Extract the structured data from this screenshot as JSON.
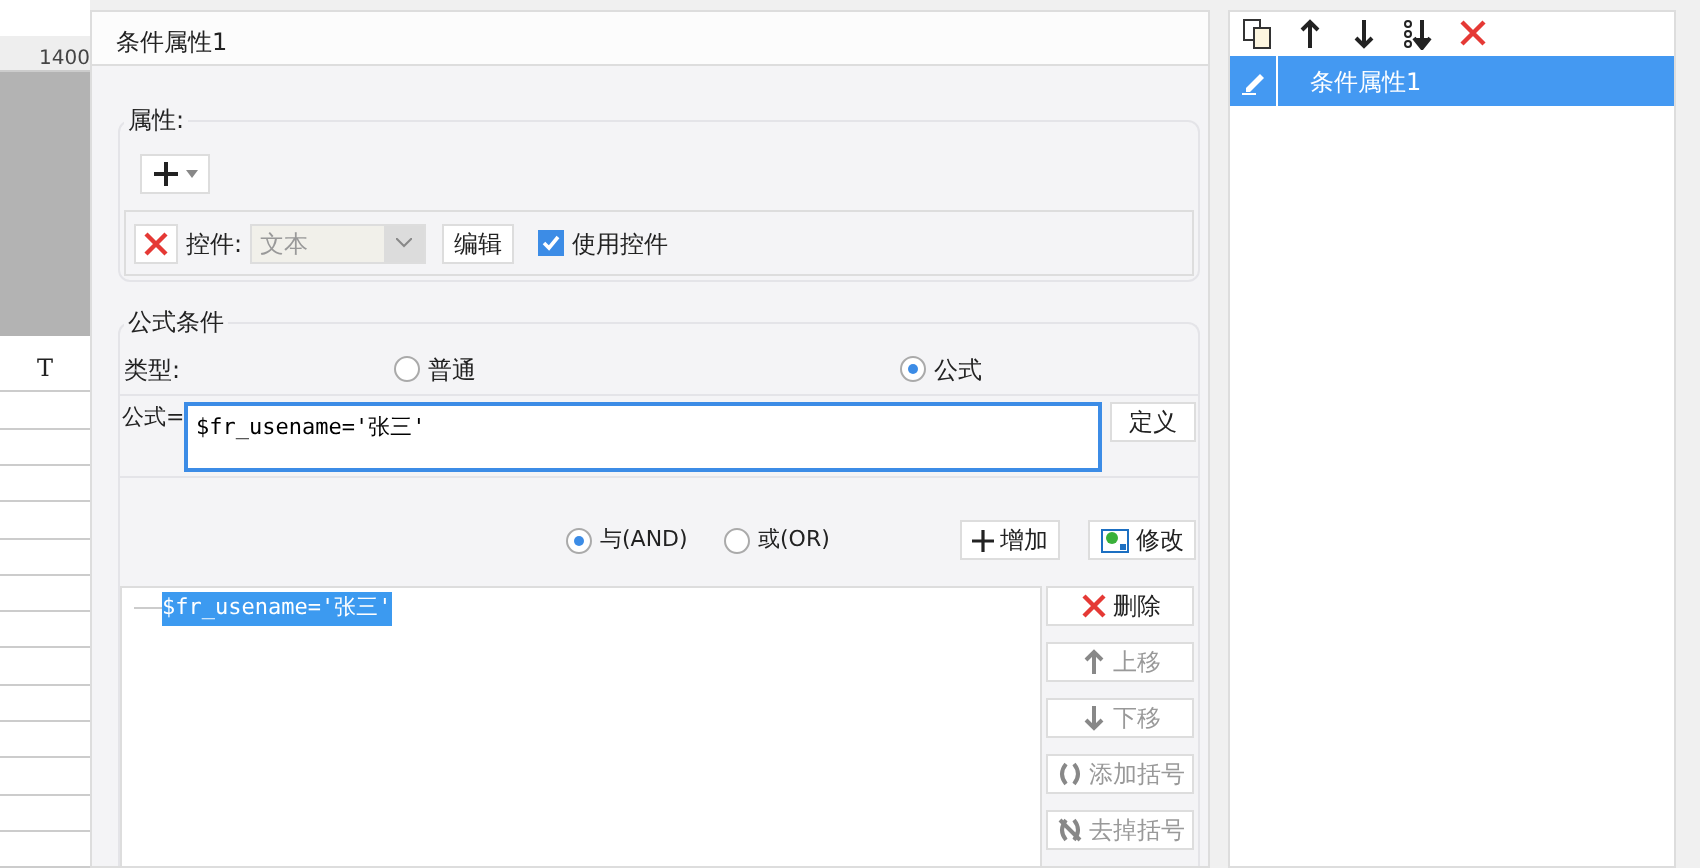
{
  "background_sheet": {
    "ruler_label": "1400",
    "column_header": "T"
  },
  "dialog": {
    "title": "条件属性1",
    "attributes_group": {
      "label": "属性:",
      "control_label": "控件:",
      "control_combo": {
        "value": "文本",
        "disabled": true
      },
      "edit_button": "编辑",
      "use_control": {
        "label": "使用控件",
        "checked": true
      }
    },
    "formula_group": {
      "label": "公式条件",
      "type_label": "类型:",
      "type_options": [
        {
          "label": "普通",
          "selected": false
        },
        {
          "label": "公式",
          "selected": true
        }
      ],
      "formula_label": "公式=",
      "formula_value": "$fr_usename='张三'",
      "define_button": "定义",
      "logic_options": [
        {
          "label": "与(AND)",
          "selected": true
        },
        {
          "label": "或(OR)",
          "selected": false
        }
      ],
      "add_button": "增加",
      "modify_button": "修改",
      "conditions": [
        {
          "text": "$fr_usename='张三'",
          "selected": true
        }
      ],
      "side_buttons": [
        {
          "kind": "delete",
          "label": "删除",
          "disabled": false
        },
        {
          "kind": "up",
          "label": "上移",
          "disabled": true
        },
        {
          "kind": "down",
          "label": "下移",
          "disabled": true
        },
        {
          "kind": "addparen",
          "label": "添加括号",
          "disabled": true
        },
        {
          "kind": "removeparen",
          "label": "去掉括号",
          "disabled": true
        }
      ]
    }
  },
  "side_panel": {
    "items": [
      {
        "label": "条件属性1",
        "selected": true
      }
    ]
  }
}
